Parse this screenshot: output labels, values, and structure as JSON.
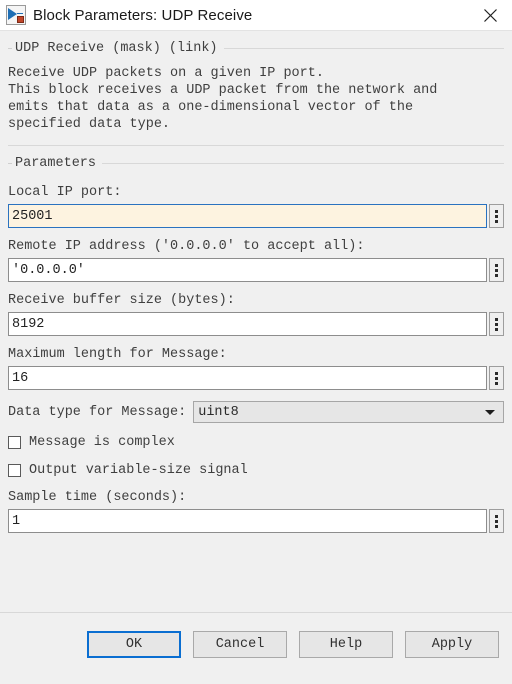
{
  "window": {
    "title": "Block Parameters: UDP Receive",
    "icon": "simulink-block-icon",
    "close_label": "close-icon"
  },
  "description": {
    "header": "UDP Receive (mask) (link)",
    "text": "Receive UDP packets on a given IP port.\nThis block receives a UDP packet from the network and\nemits that data as a one-dimensional vector of the\nspecified data type."
  },
  "parameters": {
    "group_label": "Parameters",
    "fields": [
      {
        "label": "Local IP port:",
        "value": "25001",
        "focused": true,
        "spinner": "value-picker-icon"
      },
      {
        "label": "Remote IP address ('0.0.0.0' to accept all):",
        "value": "'0.0.0.0'",
        "focused": false,
        "spinner": "value-picker-icon"
      },
      {
        "label": "Receive buffer size (bytes):",
        "value": "8192",
        "focused": false,
        "spinner": "value-picker-icon"
      },
      {
        "label": "Maximum length for Message:",
        "value": "16",
        "focused": false,
        "spinner": "value-picker-icon"
      }
    ],
    "data_type": {
      "label": "Data type for Message:",
      "value": "uint8",
      "arrow": "chevron-down-icon"
    },
    "checkboxes": [
      {
        "label": "Message is complex",
        "checked": false
      },
      {
        "label": "Output variable-size signal",
        "checked": false
      }
    ],
    "sample_time": {
      "label": "Sample time (seconds):",
      "value": "1",
      "focused": false,
      "spinner": "value-picker-icon"
    }
  },
  "footer": {
    "buttons": [
      {
        "label": "OK",
        "primary": true
      },
      {
        "label": "Cancel",
        "primary": false
      },
      {
        "label": "Help",
        "primary": false
      },
      {
        "label": "Apply",
        "primary": false
      }
    ]
  },
  "colors": {
    "dialog_background": "#f0f0f0",
    "titlebar_background": "#ffffff",
    "focus_border": "#2a72c0",
    "focus_field_background": "#fdf3e0",
    "primary_button_border": "#0a6ed1",
    "text": "#3f3f3f"
  }
}
